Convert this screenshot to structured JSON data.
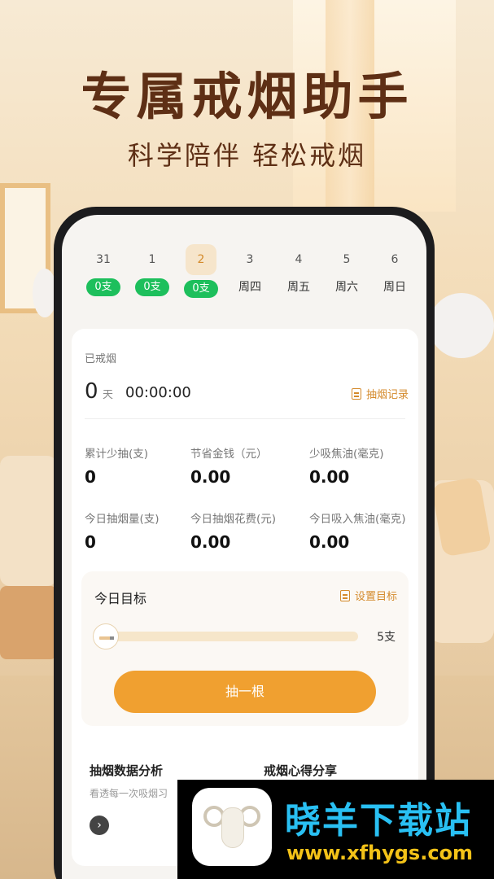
{
  "promo": {
    "headline": "专属戒烟助手",
    "subline": "科学陪伴 轻松戒烟"
  },
  "week_strip": [
    {
      "num": "31",
      "badge": "0支",
      "weekday": ""
    },
    {
      "num": "1",
      "badge": "0支",
      "weekday": ""
    },
    {
      "num": "2",
      "badge": "0支",
      "weekday": "",
      "selected": true
    },
    {
      "num": "3",
      "badge": "",
      "weekday": "周四"
    },
    {
      "num": "4",
      "badge": "",
      "weekday": "周五"
    },
    {
      "num": "5",
      "badge": "",
      "weekday": "周六"
    },
    {
      "num": "6",
      "badge": "",
      "weekday": "周日"
    }
  ],
  "quit": {
    "label": "已戒烟",
    "days": "0",
    "days_unit": "天",
    "timer": "00:00:00",
    "record_link": "抽烟记录"
  },
  "stats": [
    {
      "label": "累计少抽(支)",
      "value": "0"
    },
    {
      "label": "节省金钱（元）",
      "value": "0.00"
    },
    {
      "label": "少吸焦油(毫克)",
      "value": "0.00"
    },
    {
      "label": "今日抽烟量(支)",
      "value": "0"
    },
    {
      "label": "今日抽烟花费(元)",
      "value": "0.00"
    },
    {
      "label": "今日吸入焦油(毫克)",
      "value": "0.00"
    }
  ],
  "goal": {
    "title": "今日目标",
    "set_link": "设置目标",
    "max_label": "5支",
    "progress_fraction": 0,
    "button": "抽一根"
  },
  "cards": [
    {
      "title": "抽烟数据分析",
      "subtitle": "看透每一次吸烟习"
    },
    {
      "title": "戒烟心得分享",
      "subtitle": ""
    }
  ],
  "watermark": {
    "name": "晓羊下载站",
    "url": "www.xfhygs.com"
  },
  "colors": {
    "accent": "#f0a030",
    "badge_green": "#1dbf5c",
    "headline_brown": "#5e2f15",
    "watermark_blue": "#29c0f3",
    "watermark_yellow": "#f3c218"
  }
}
